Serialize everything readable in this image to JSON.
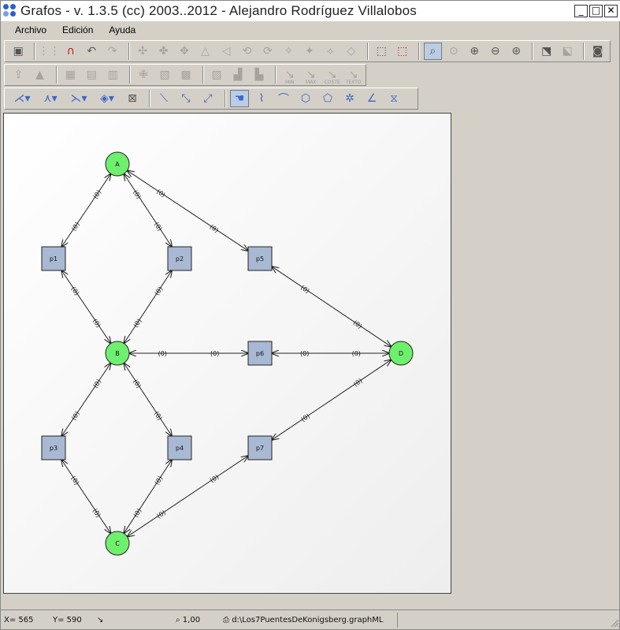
{
  "window": {
    "title": "Grafos - v. 1.3.5  (cc) 2003..2012 - Alejandro Rodríguez Villalobos",
    "min_label": "_",
    "max_label": "□",
    "close_label": "✕"
  },
  "menu": {
    "items": [
      {
        "label": "Archivo"
      },
      {
        "label": "Edición"
      },
      {
        "label": "Ayuda"
      }
    ]
  },
  "toolbar2": {
    "labels": [
      "MIN",
      "MAX",
      "COSTE",
      "TEXTO"
    ]
  },
  "statusbar": {
    "x_readout": "X= 565",
    "y_readout": "Y= 590",
    "zoom": "1,00",
    "file_path": "d:\\Los7PuentesDeKonigsberg.graphML"
  },
  "graph": {
    "nodes": [
      {
        "id": "A",
        "label": "A",
        "shape": "circle",
        "color": "#6ef06e"
      },
      {
        "id": "B",
        "label": "B",
        "shape": "circle",
        "color": "#6ef06e"
      },
      {
        "id": "C",
        "label": "C",
        "shape": "circle",
        "color": "#6ef06e"
      },
      {
        "id": "D",
        "label": "D",
        "shape": "circle",
        "color": "#6ef06e"
      },
      {
        "id": "p1",
        "label": "p1",
        "shape": "square",
        "color": "#a9b9d4"
      },
      {
        "id": "p2",
        "label": "p2",
        "shape": "square",
        "color": "#a9b9d4"
      },
      {
        "id": "p3",
        "label": "p3",
        "shape": "square",
        "color": "#a9b9d4"
      },
      {
        "id": "p4",
        "label": "p4",
        "shape": "square",
        "color": "#a9b9d4"
      },
      {
        "id": "p5",
        "label": "p5",
        "shape": "square",
        "color": "#a9b9d4"
      },
      {
        "id": "p6",
        "label": "p6",
        "shape": "square",
        "color": "#a9b9d4"
      },
      {
        "id": "p7",
        "label": "p7",
        "shape": "square",
        "color": "#a9b9d4"
      }
    ],
    "edges": [
      {
        "from": "p1",
        "to": "A",
        "label": "(0)"
      },
      {
        "from": "A",
        "to": "p1",
        "label": "(0)"
      },
      {
        "from": "p2",
        "to": "A",
        "label": "(0)"
      },
      {
        "from": "A",
        "to": "p2",
        "label": "(0)"
      },
      {
        "from": "p5",
        "to": "A",
        "label": "(0)"
      },
      {
        "from": "A",
        "to": "p5",
        "label": "(0)"
      },
      {
        "from": "p1",
        "to": "B",
        "label": "(0)"
      },
      {
        "from": "B",
        "to": "p1",
        "label": "(0)"
      },
      {
        "from": "p2",
        "to": "B",
        "label": "(0)"
      },
      {
        "from": "B",
        "to": "p2",
        "label": "(0)"
      },
      {
        "from": "p6",
        "to": "B",
        "label": "(0)"
      },
      {
        "from": "B",
        "to": "p6",
        "label": "(0)"
      },
      {
        "from": "p3",
        "to": "B",
        "label": "(0)"
      },
      {
        "from": "B",
        "to": "p3",
        "label": "(0)"
      },
      {
        "from": "p4",
        "to": "B",
        "label": "(0)"
      },
      {
        "from": "B",
        "to": "p4",
        "label": "(0)"
      },
      {
        "from": "p3",
        "to": "C",
        "label": "(0)"
      },
      {
        "from": "C",
        "to": "p3",
        "label": "(0)"
      },
      {
        "from": "p4",
        "to": "C",
        "label": "(0)"
      },
      {
        "from": "C",
        "to": "p4",
        "label": "(0)"
      },
      {
        "from": "p7",
        "to": "C",
        "label": "(0)"
      },
      {
        "from": "C",
        "to": "p7",
        "label": "(0)"
      },
      {
        "from": "p5",
        "to": "D",
        "label": "(0)"
      },
      {
        "from": "D",
        "to": "p5",
        "label": "(0)"
      },
      {
        "from": "p6",
        "to": "D",
        "label": "(0)"
      },
      {
        "from": "D",
        "to": "p6",
        "label": "(0)"
      },
      {
        "from": "p7",
        "to": "D",
        "label": "(0)"
      },
      {
        "from": "D",
        "to": "p7",
        "label": "(0)"
      }
    ]
  }
}
